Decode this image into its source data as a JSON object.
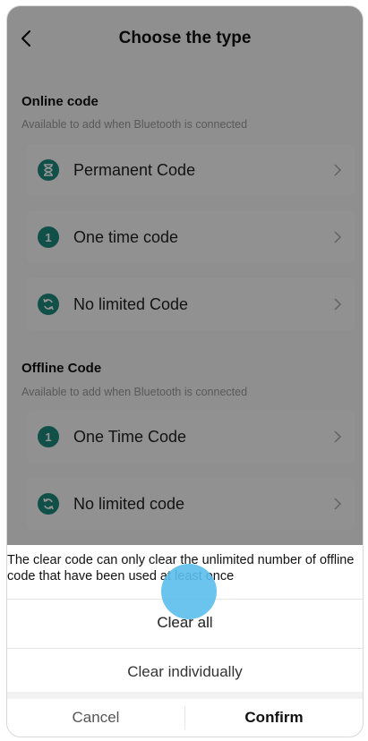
{
  "header": {
    "title": "Choose the type"
  },
  "sections": [
    {
      "title": "Online code",
      "subtitle": "Available to add when Bluetooth is connected",
      "items": [
        {
          "label": "Permanent Code",
          "icon": "hourglass-icon"
        },
        {
          "label": "One time code",
          "icon": "one-badge-icon",
          "badge": "1"
        },
        {
          "label": "No limited Code",
          "icon": "loop-icon"
        }
      ]
    },
    {
      "title": "Offline Code",
      "subtitle": "Available to add when Bluetooth is connected",
      "items": [
        {
          "label": "One Time Code",
          "icon": "one-badge-icon",
          "badge": "1"
        },
        {
          "label": "No limited code",
          "icon": "loop-icon"
        }
      ]
    }
  ],
  "sheet": {
    "message": "The clear code can only clear the unlimited number of offline code that have been used at least once",
    "options": [
      "Clear all",
      "Clear individually"
    ],
    "cancel_label": "Cancel",
    "confirm_label": "Confirm"
  },
  "colors": {
    "accent": "#1e8a7c",
    "touch": "#5abeeb"
  }
}
